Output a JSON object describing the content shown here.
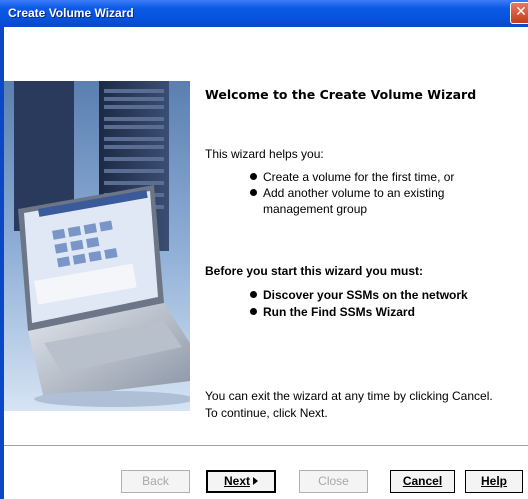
{
  "window": {
    "title": "Create Volume Wizard"
  },
  "heading": "Welcome to the Create Volume Wizard",
  "intro": "This wizard helps you:",
  "help_items": [
    "Create a volume for the first time, or",
    "Add another volume to an existing",
    "management group"
  ],
  "prereq_heading": "Before you start this wizard you must:",
  "prereq_items": [
    "Discover your SSMs on the network",
    "Run the Find SSMs Wizard"
  ],
  "footer_lines": [
    "You can exit the wizard at any time by clicking Cancel.",
    "To continue, click Next."
  ],
  "buttons": {
    "back": "Back",
    "next": "Next",
    "close": "Close",
    "cancel": "Cancel",
    "help": "Help"
  },
  "icons": {
    "close": "close-icon",
    "next_arrow": "arrow-right-icon",
    "bullet": "bullet-icon"
  },
  "colors": {
    "titlebar": "#0852dc",
    "close_button": "#c8391a"
  }
}
